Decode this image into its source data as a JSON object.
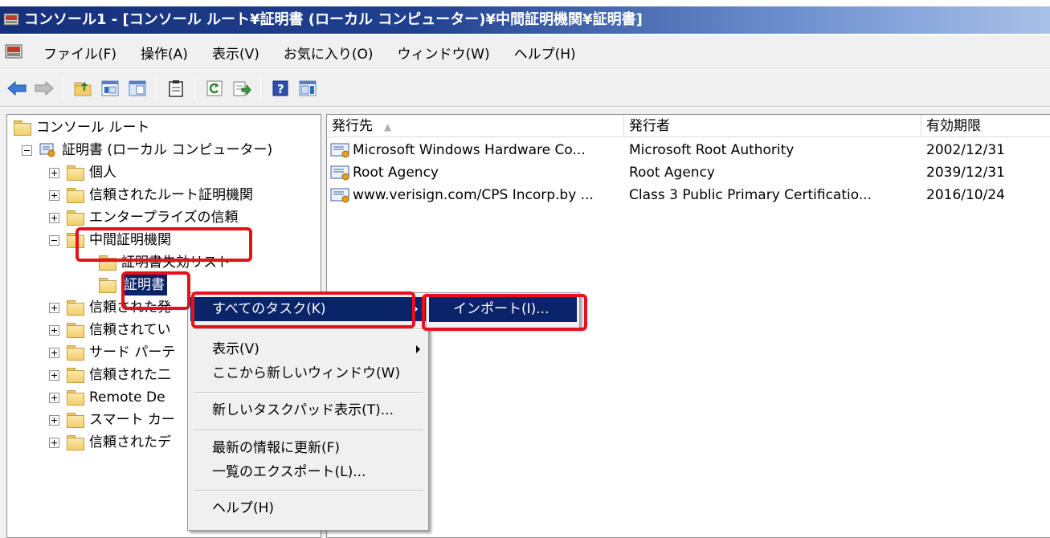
{
  "window": {
    "title": "コンソール1 - [コンソール ルート¥証明書 (ローカル コンピューター)¥中間証明機関¥証明書]"
  },
  "menu": {
    "items": [
      "ファイル(F)",
      "操作(A)",
      "表示(V)",
      "お気に入り(O)",
      "ウィンドウ(W)",
      "ヘルプ(H)"
    ]
  },
  "tree": {
    "root": "コンソール ルート",
    "certificates_local": "証明書 (ローカル コンピューター)",
    "personal": "個人",
    "trusted_root": "信頼されたルート証明機関",
    "enterprise_trust": "エンタープライズの信頼",
    "intermediate": "中間証明機関",
    "crl": "証明書失効リスト",
    "certificates": "証明書",
    "trusted_publishers": "信頼された発",
    "untrusted": "信頼されてい",
    "third_party": "サード パーテ",
    "trusted_people": "信頼された二",
    "remote_desktop": "Remote De",
    "smart_card": "スマート カー",
    "trusted_devices": "信頼されたデ"
  },
  "list": {
    "columns": [
      "発行先",
      "発行者",
      "有効期限"
    ],
    "rows": [
      {
        "issued_to": "Microsoft Windows Hardware Co...",
        "issued_by": "Microsoft Root Authority",
        "expires": "2002/12/31"
      },
      {
        "issued_to": "Root Agency",
        "issued_by": "Root Agency",
        "expires": "2039/12/31"
      },
      {
        "issued_to": "www.verisign.com/CPS Incorp.by ...",
        "issued_by": "Class 3 Public Primary Certificatio...",
        "expires": "2016/10/24"
      }
    ]
  },
  "context_menu": {
    "all_tasks": "すべてのタスク(K)",
    "view": "表示(V)",
    "new_window": "ここから新しいウィンドウ(W)",
    "new_taskpad": "新しいタスクパッド表示(T)...",
    "refresh": "最新の情報に更新(F)",
    "export_list": "一覧のエクスポート(L)...",
    "help": "ヘルプ(H)"
  },
  "submenu": {
    "import": "インポート(I)..."
  },
  "colors": {
    "selection": "#0a246a",
    "callout": "#e8101a",
    "titlebar": "#16307c"
  }
}
